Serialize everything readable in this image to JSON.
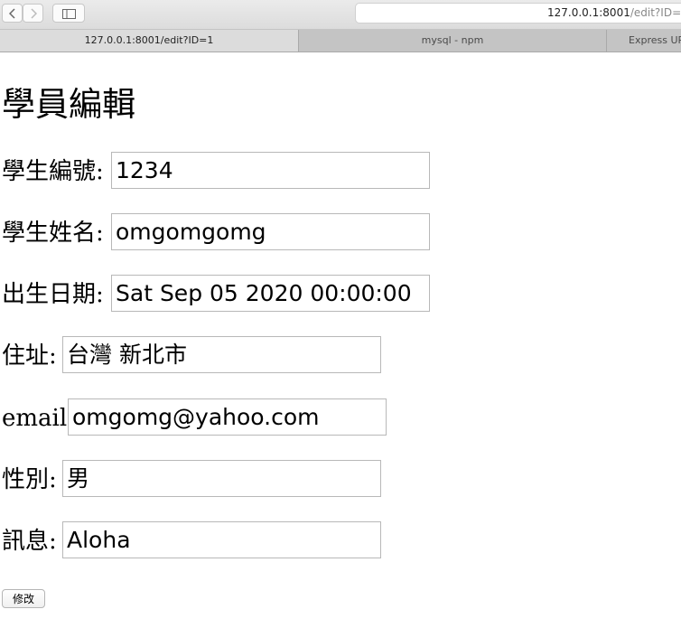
{
  "browser": {
    "address_host": "127.0.0.1:8001",
    "address_path": "/edit?ID=1",
    "tabs": [
      {
        "label": "127.0.0.1:8001/edit?ID=1"
      },
      {
        "label": "mysql - npm"
      },
      {
        "label": "Express UR"
      }
    ]
  },
  "page": {
    "title": "學員編輯",
    "fields": [
      {
        "label": "學生編號:",
        "value": "1234"
      },
      {
        "label": "學生姓名:",
        "value": "omgomgomg"
      },
      {
        "label": "出生日期:",
        "value": "Sat Sep 05 2020 00:00:00"
      },
      {
        "label": "住址:",
        "value": "台灣 新北市"
      },
      {
        "label": "email:",
        "value": "omgomg@yahoo.com"
      },
      {
        "label": "性別:",
        "value": "男"
      },
      {
        "label": "訊息:",
        "value": "Aloha"
      }
    ],
    "submit_label": "修改"
  }
}
